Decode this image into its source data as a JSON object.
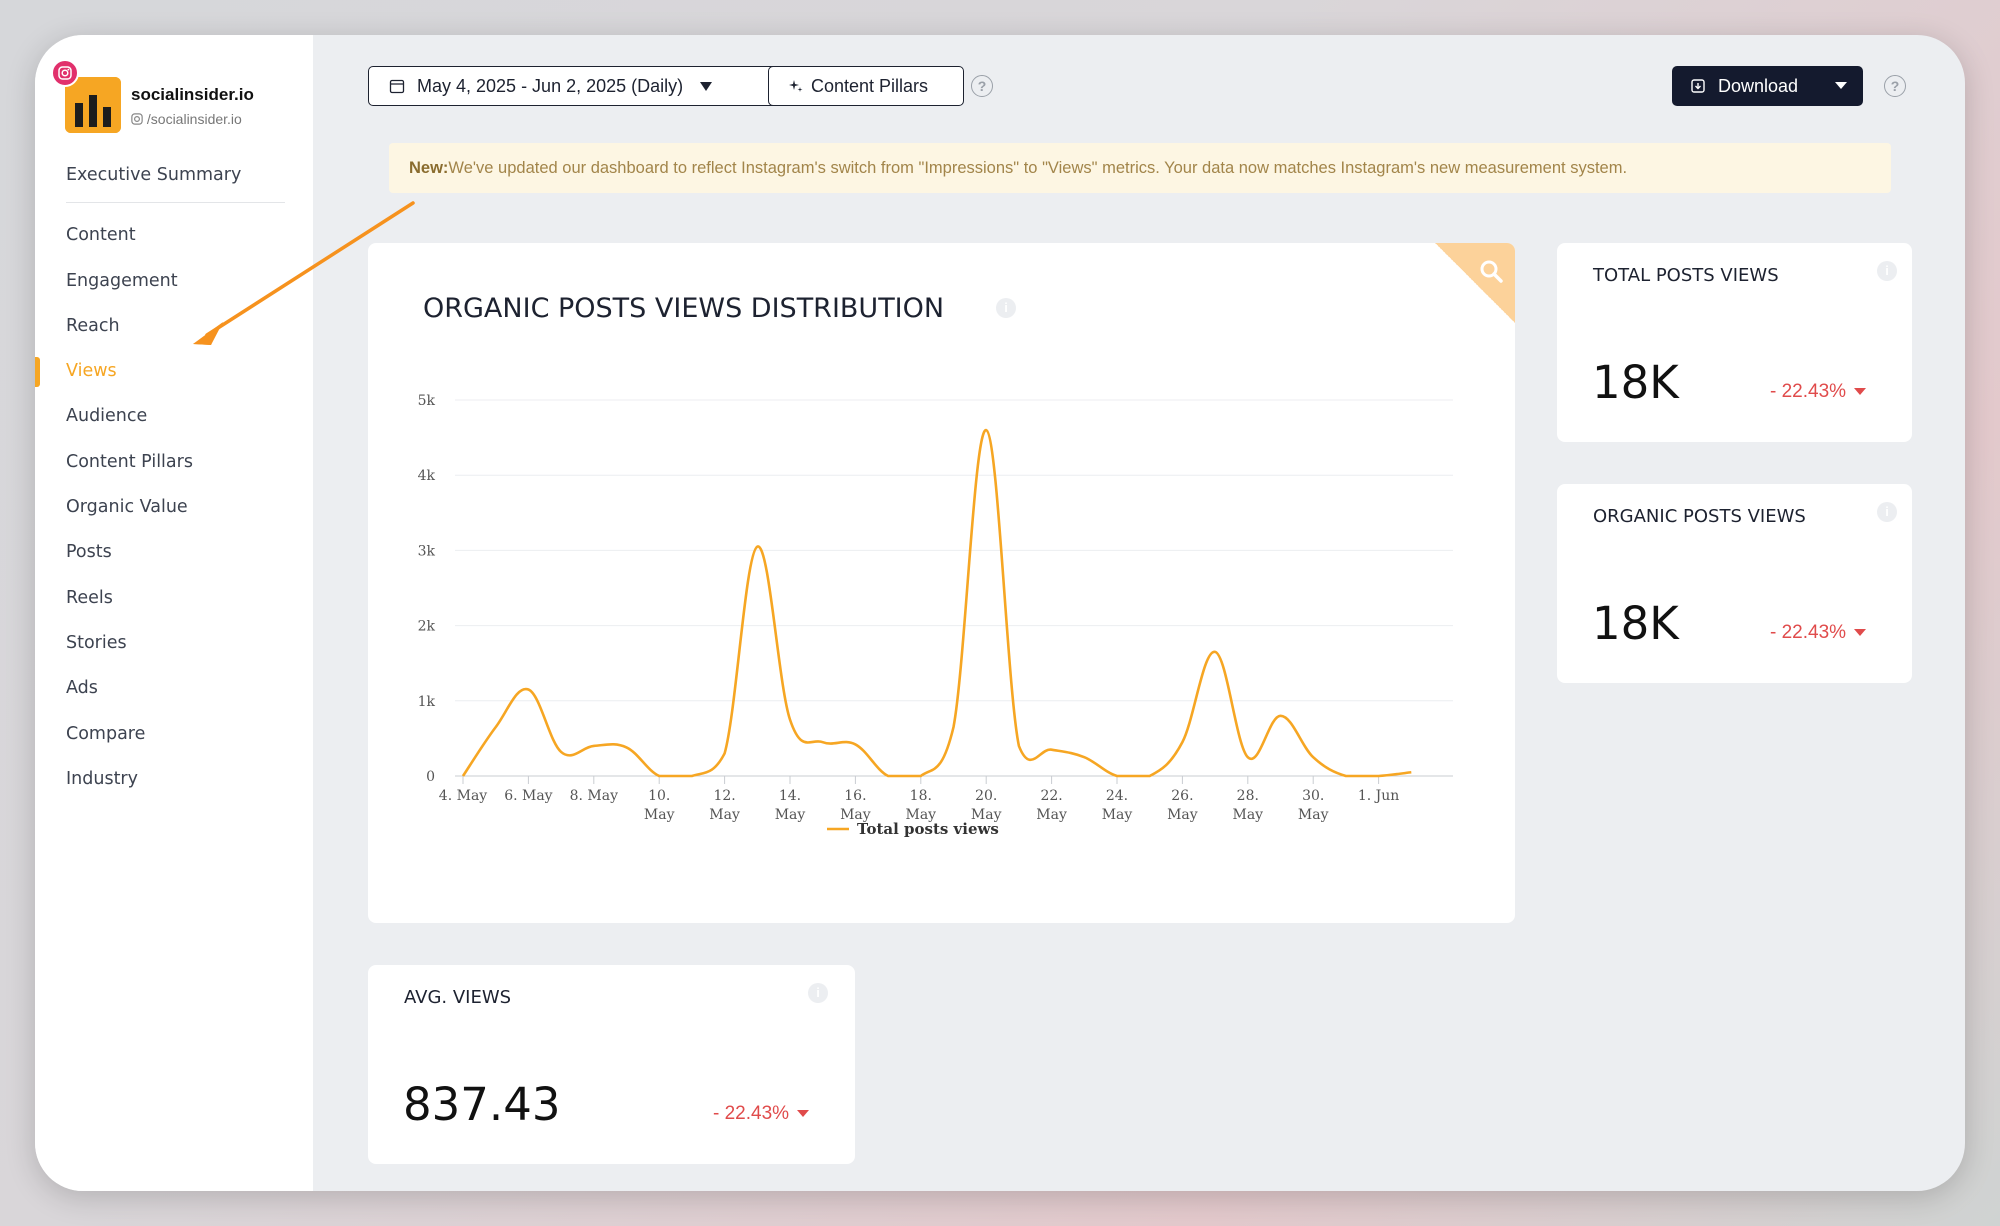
{
  "profile": {
    "name": "socialinsider.io",
    "handle": "/socialinsider.io"
  },
  "sidebar": {
    "items": [
      {
        "label": "Executive Summary"
      },
      {
        "label": "Content"
      },
      {
        "label": "Engagement"
      },
      {
        "label": "Reach"
      },
      {
        "label": "Views"
      },
      {
        "label": "Audience"
      },
      {
        "label": "Content Pillars"
      },
      {
        "label": "Organic Value"
      },
      {
        "label": "Posts"
      },
      {
        "label": "Reels"
      },
      {
        "label": "Stories"
      },
      {
        "label": "Ads"
      },
      {
        "label": "Compare"
      },
      {
        "label": "Industry"
      }
    ],
    "active": "Views"
  },
  "toolbar": {
    "date_range": "May 4, 2025 - Jun 2, 2025 (Daily)",
    "content_pillars": "Content Pillars",
    "download": "Download",
    "help": "?"
  },
  "notice": {
    "prefix": "New:",
    "text": "We've updated our dashboard to reflect Instagram's switch from \"Impressions\" to \"Views\" metrics. Your data now matches Instagram's new measurement system."
  },
  "chart_card": {
    "title": "ORGANIC POSTS VIEWS DISTRIBUTION"
  },
  "chart_data": {
    "type": "line",
    "title": "ORGANIC POSTS VIEWS DISTRIBUTION",
    "xlabel": "",
    "ylabel": "",
    "ylim": [
      0,
      5000
    ],
    "yticks": [
      {
        "value": 0,
        "label": "0"
      },
      {
        "value": 1000,
        "label": "1k"
      },
      {
        "value": 2000,
        "label": "2k"
      },
      {
        "value": 3000,
        "label": "3k"
      },
      {
        "value": 4000,
        "label": "4k"
      },
      {
        "value": 5000,
        "label": "5k"
      }
    ],
    "xticks": [
      {
        "day": 0,
        "label": [
          "4. May"
        ]
      },
      {
        "day": 2,
        "label": [
          "6. May"
        ]
      },
      {
        "day": 4,
        "label": [
          "8. May"
        ]
      },
      {
        "day": 6,
        "label": [
          "10.",
          "May"
        ]
      },
      {
        "day": 8,
        "label": [
          "12.",
          "May"
        ]
      },
      {
        "day": 10,
        "label": [
          "14.",
          "May"
        ]
      },
      {
        "day": 12,
        "label": [
          "16.",
          "May"
        ]
      },
      {
        "day": 14,
        "label": [
          "18.",
          "May"
        ]
      },
      {
        "day": 16,
        "label": [
          "20.",
          "May"
        ]
      },
      {
        "day": 18,
        "label": [
          "22.",
          "May"
        ]
      },
      {
        "day": 20,
        "label": [
          "24.",
          "May"
        ]
      },
      {
        "day": 22,
        "label": [
          "26.",
          "May"
        ]
      },
      {
        "day": 24,
        "label": [
          "28.",
          "May"
        ]
      },
      {
        "day": 26,
        "label": [
          "30.",
          "May"
        ]
      },
      {
        "day": 28,
        "label": [
          "1. Jun"
        ]
      }
    ],
    "series": [
      {
        "name": "Total posts views",
        "color": "#f6a623",
        "x": [
          "4. May",
          "5. May",
          "6. May",
          "7. May",
          "8. May",
          "9. May",
          "10. May",
          "11. May",
          "12. May",
          "13. May",
          "14. May",
          "15. May",
          "16. May",
          "17. May",
          "18. May",
          "19. May",
          "20. May",
          "21. May",
          "22. May",
          "23. May",
          "24. May",
          "25. May",
          "26. May",
          "27. May",
          "28. May",
          "29. May",
          "30. May",
          "31. May",
          "1. Jun",
          "2. Jun"
        ],
        "values": [
          0,
          650,
          1150,
          320,
          400,
          380,
          0,
          0,
          300,
          3050,
          750,
          450,
          420,
          0,
          0,
          650,
          4600,
          400,
          350,
          250,
          0,
          0,
          450,
          1650,
          250,
          800,
          250,
          0,
          0,
          50
        ]
      }
    ],
    "legend": "bottom-center",
    "grid": true
  },
  "kpis": [
    {
      "title": "TOTAL POSTS VIEWS",
      "value": "18K",
      "change": "- 22.43%"
    },
    {
      "title": "ORGANIC POSTS VIEWS",
      "value": "18K",
      "change": "- 22.43%"
    },
    {
      "title": "AVG. VIEWS",
      "value": "837.43",
      "change": "- 22.43%"
    }
  ],
  "colors": {
    "accent": "#f6a623",
    "negative": "#e04b4b",
    "dark_button": "#141a2e"
  },
  "icons": {
    "calendar": "calendar-icon",
    "sparkle": "sparkle-icon",
    "download": "download-icon",
    "search": "search-icon",
    "instagram": "instagram-icon",
    "info": "info-icon",
    "annotation_arrow": "arrow-annotation"
  }
}
